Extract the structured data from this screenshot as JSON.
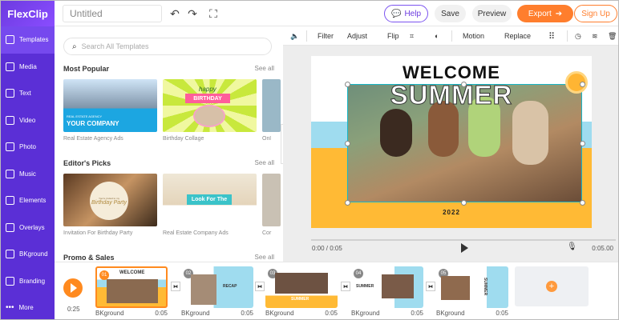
{
  "app": {
    "logo": "FlexClip",
    "project_title": "Untitled"
  },
  "topbar": {
    "help": "Help",
    "save": "Save",
    "preview": "Preview",
    "export": "Export",
    "signup": "Sign Up"
  },
  "nav": [
    {
      "label": "Templates",
      "icon": "templates-icon"
    },
    {
      "label": "Media",
      "icon": "media-icon"
    },
    {
      "label": "Text",
      "icon": "text-icon"
    },
    {
      "label": "Video",
      "icon": "video-icon"
    },
    {
      "label": "Photo",
      "icon": "photo-icon"
    },
    {
      "label": "Music",
      "icon": "music-icon"
    },
    {
      "label": "Elements",
      "icon": "elements-icon"
    },
    {
      "label": "Overlays",
      "icon": "overlays-icon"
    },
    {
      "label": "BKground",
      "icon": "background-icon"
    },
    {
      "label": "Branding",
      "icon": "branding-icon"
    },
    {
      "label": "More",
      "icon": "more-icon"
    }
  ],
  "panel": {
    "search_placeholder": "Search All Templates",
    "sections": [
      {
        "title": "Most Popular",
        "see_all": "See all",
        "items": [
          "Real Estate Agency Ads",
          "Birthday Collage",
          "Onl"
        ]
      },
      {
        "title": "Editor's Picks",
        "see_all": "See all",
        "items": [
          "Invitation For Birthday Party",
          "Real Estate Company Ads",
          "Cor"
        ]
      },
      {
        "title": "Promo & Sales",
        "see_all": "See all"
      }
    ],
    "thumb_text": {
      "company": "YOUR COMPANY",
      "company_sub": "REAL ESTATE AGENCY",
      "happy": "happy",
      "birthday": "BIRTHDAY",
      "invite_small": "You're invited to my",
      "invite_big": "Birthday Party",
      "look": "Look For The"
    }
  },
  "editor_toolbar": {
    "filter": "Filter",
    "adjust": "Adjust",
    "flip": "Flip",
    "motion": "Motion",
    "replace": "Replace"
  },
  "canvas": {
    "welcome": "WELCOME",
    "summer": "SUMMER",
    "year": "2022"
  },
  "playback": {
    "current": "0:00 / 0:05",
    "total": "0:05.00"
  },
  "timeline": {
    "total_time": "0:25",
    "scenes": [
      {
        "num": "01",
        "label": "BKground",
        "duration": "0:05",
        "title": "WELCOME"
      },
      {
        "num": "02",
        "label": "BKground",
        "duration": "0:05",
        "title": "RECAP"
      },
      {
        "num": "03",
        "label": "BKground",
        "duration": "0:05",
        "title": "SUMMER"
      },
      {
        "num": "04",
        "label": "BKground",
        "duration": "0:05",
        "title": "SUMMER"
      },
      {
        "num": "05",
        "label": "BKground",
        "duration": "0:05",
        "title": "SUMMER"
      }
    ]
  },
  "colors": {
    "brand": "#5b2fd6",
    "accent": "#ff7e2d",
    "canvas_blue": "#9fdcef",
    "canvas_yellow": "#ffba35",
    "selection": "#18b6c8"
  }
}
